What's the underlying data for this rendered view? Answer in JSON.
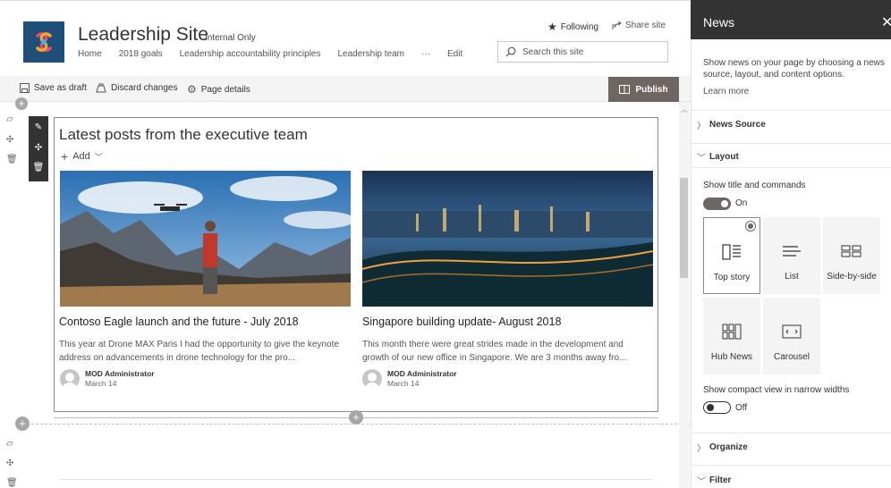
{
  "header": {
    "site_title": "Leadership Site",
    "internal_label": "Internal Only",
    "nav": [
      "Home",
      "2018 goals",
      "Leadership accountability principles",
      "Leadership team",
      "···",
      "Edit"
    ],
    "following_label": "Following",
    "share_label": "Share site",
    "search_placeholder": "Search this site"
  },
  "commandbar": {
    "save_draft": "Save as draft",
    "discard": "Discard changes",
    "page_details": "Page details",
    "publish": "Publish"
  },
  "webpart": {
    "title": "Latest posts from the executive team",
    "add_label": "Add",
    "posts": [
      {
        "title": "Contoso Eagle launch and the future - July 2018",
        "description": "This year at Drone MAX Paris I had the opportunity to give the keynote address on advancements in drone technology for the pro...",
        "author": "MOD Administrator",
        "date": "March 14"
      },
      {
        "title": "Singapore building update- August 2018",
        "description": "This month there were great strides made in the development and growth of our new office in Singapore. We are 3 months away fro...",
        "author": "MOD Administrator",
        "date": "March 14"
      }
    ]
  },
  "panel": {
    "title": "News",
    "description": "Show news on your page by choosing a news source, layout, and content options.",
    "learn_more": "Learn more",
    "sections": {
      "news_source": "News Source",
      "layout": "Layout",
      "organize": "Organize",
      "filter": "Filter"
    },
    "show_title_label": "Show title and commands",
    "show_title_state": "On",
    "layouts": [
      "Top story",
      "List",
      "Side-by-side",
      "Hub News",
      "Carousel"
    ],
    "selected_layout": "Top story",
    "compact_label": "Show compact view in narrow widths",
    "compact_state": "Off"
  },
  "colors": {
    "accent": "#6e6663",
    "panel_header": "#333333",
    "logo_bg": "#1f4e79"
  }
}
